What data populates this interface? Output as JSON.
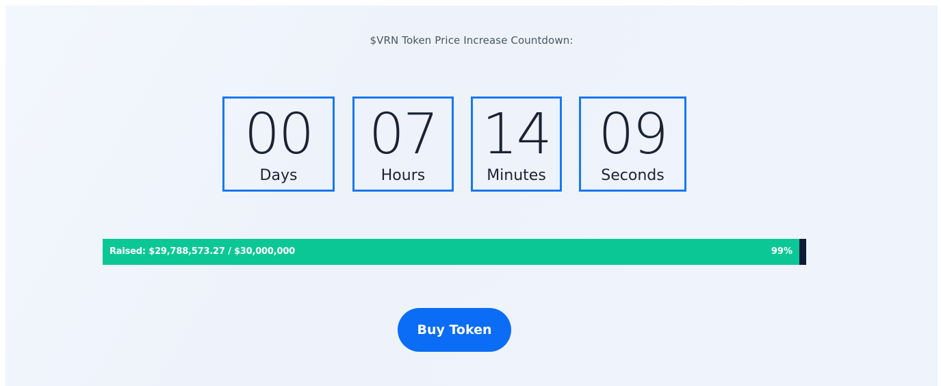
{
  "countdown": {
    "title": "$VRN Token Price Increase Countdown:",
    "units": [
      {
        "value": "00",
        "label": "Days"
      },
      {
        "value": "07",
        "label": "Hours"
      },
      {
        "value": "14",
        "label": "Minutes"
      },
      {
        "value": "09",
        "label": "Seconds"
      }
    ]
  },
  "progress": {
    "text": "Raised: $29,788,573.27 / $30,000,000",
    "percent_label": "99%",
    "fraction": 0.99
  },
  "cta": {
    "label": "Buy Token"
  },
  "colors": {
    "accent": "#1877f2",
    "progress_green": "#0bc795",
    "button_blue": "#0b6cf5"
  }
}
